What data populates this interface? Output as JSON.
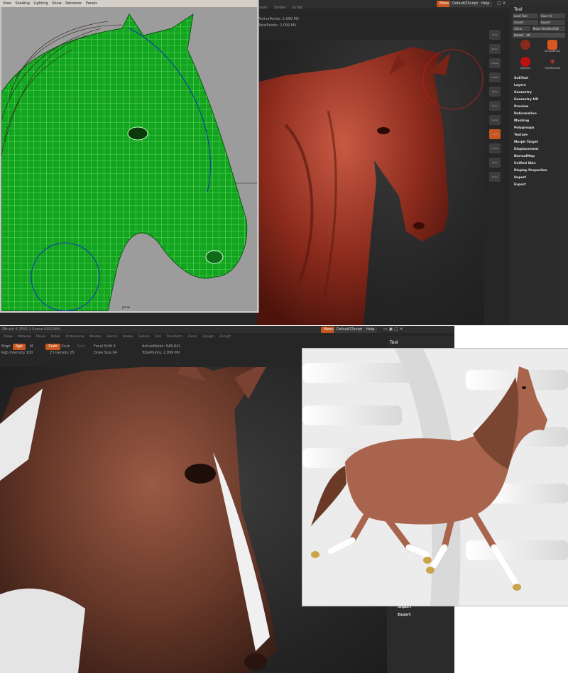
{
  "zb_top": {
    "menu": [
      "Zoom",
      "Stroke",
      "Script"
    ],
    "header_buttons": [
      "Menus",
      "DefaultZScript",
      "Help"
    ],
    "active_points": "ActivePoints: 2.099 Mil",
    "total_points": "TotalPoints: 2.099 Mil",
    "shelf_buttons": [
      "Scroll",
      "Zoom",
      "Actual",
      "AAHalf",
      "Persp",
      "Floor",
      "Local",
      "L.Sym",
      "Frame",
      "Move",
      "Scale",
      "Rotate",
      "PolyF",
      "Transp",
      "Ghost",
      "Solo",
      "Xpose"
    ],
    "tool_panel": {
      "title": "Tool",
      "row1": [
        "Load Tool",
        "Save As"
      ],
      "row2": [
        "Import",
        "Export"
      ],
      "row3": [
        "Clone",
        "Make PolyMesh3D"
      ],
      "slider": "horse1 : 46",
      "thumbs": [
        {
          "label": "SimpleBrush"
        },
        {
          "label": "Sphere3D"
        },
        {
          "label": "ZSphere"
        },
        {
          "label": "PolyMesh3D"
        },
        {
          "label": "horse1"
        }
      ],
      "menu_items": [
        "SubTool",
        "Layers",
        "Geometry",
        "Geometry HD",
        "Preview",
        "Deformation",
        "Masking",
        "Polygroups",
        "Texture",
        "Morph Target",
        "Displacement",
        "NormalMap",
        "Unified Skin",
        "Display Properties",
        "Import",
        "Export"
      ]
    }
  },
  "maya": {
    "menu": [
      "View",
      "Shading",
      "Lighting",
      "Show",
      "Renderer",
      "Panels"
    ],
    "camera_label": "persp"
  },
  "zb_bot": {
    "header": "ZBrush 4 2555 2 Scene 0002484",
    "menu": [
      "Alpha",
      "Brush",
      "Color",
      "Document",
      "Draw",
      "Edit",
      "File",
      "Layer",
      "Light",
      "Macro",
      "Marker",
      "Material",
      "Movie",
      "Picker",
      "Preferences",
      "Render",
      "Stencil",
      "Stroke",
      "Texture",
      "Tool",
      "Transform",
      "Zoom",
      "Zplugin",
      "Zscript"
    ],
    "header_buttons": [
      "Menus",
      "DefaultZScript",
      "Help"
    ],
    "params": {
      "rgb_label": "Rgb",
      "m_label": "M",
      "mrgb": "Mrgb",
      "rgb_intensity": "Rgb Intensity 100",
      "zadd": "Zadd",
      "zsub": "Zsub",
      "zcut": "Zcut",
      "z_intensity": "Z Intensity 25",
      "focal_shift": "Focal Shift 0",
      "draw_size": "Draw Size 64",
      "active_points": "ActivePoints: 946,841",
      "total_points": "TotalPoints: 2.099 Mil"
    },
    "tool_row": [
      "Load Tool",
      "Save As"
    ],
    "bottom_menu": [
      "Import",
      "Export"
    ]
  },
  "colors": {
    "zbrush_bg": "#262626",
    "accent": "#c8561f",
    "maya_wire": "#22e02e",
    "clay": "#8a2a1c",
    "coat": "#6a3a2a"
  }
}
